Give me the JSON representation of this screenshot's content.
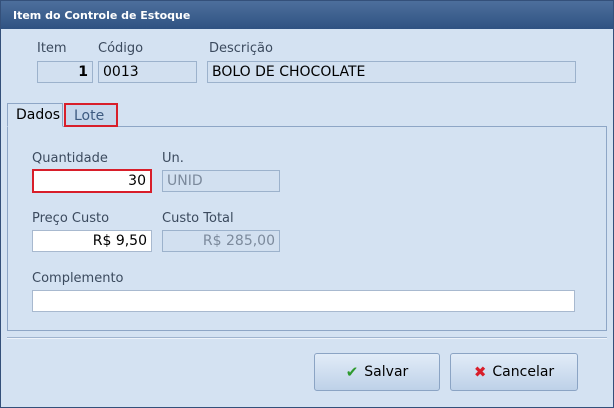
{
  "window": {
    "title": "Item do Controle de Estoque"
  },
  "header": {
    "item_label": "Item",
    "item_value": "1",
    "codigo_label": "Código",
    "codigo_value": "0013",
    "descricao_label": "Descrição",
    "descricao_value": "BOLO DE CHOCOLATE"
  },
  "tabs": [
    {
      "label": "Dados",
      "active": true
    },
    {
      "label": "Lote",
      "active": false
    }
  ],
  "dados": {
    "quantidade_label": "Quantidade",
    "quantidade_value": "30",
    "un_label": "Un.",
    "un_value": "UNID",
    "preco_label": "Preço Custo",
    "preco_value": "R$ 9,50",
    "custo_total_label": "Custo Total",
    "custo_total_value": "R$ 285,00",
    "complemento_label": "Complemento",
    "complemento_value": ""
  },
  "buttons": {
    "salvar_label": "Salvar",
    "cancelar_label": "Cancelar"
  },
  "icons": {
    "salvar": "checkmark-icon",
    "cancelar": "x-icon"
  },
  "colors": {
    "highlight": "#d81e2a",
    "accent": "#2f5282"
  }
}
